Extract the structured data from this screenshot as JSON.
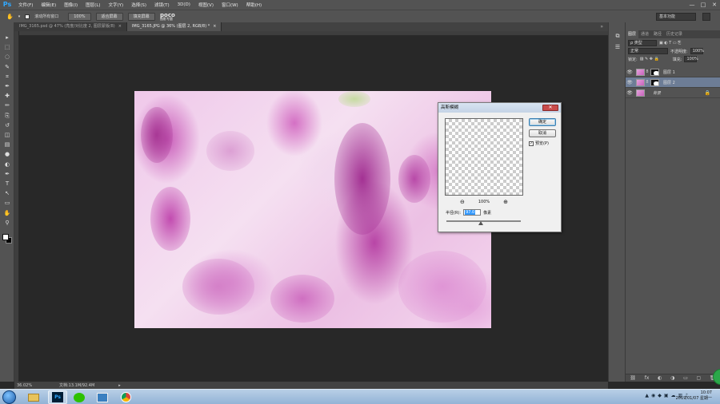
{
  "app": {
    "logo": "Ps",
    "menu": [
      "文件(F)",
      "编辑(E)",
      "图像(I)",
      "图层(L)",
      "文字(Y)",
      "选择(S)",
      "滤镜(T)",
      "3D(D)",
      "视图(V)",
      "窗口(W)",
      "帮助(H)"
    ],
    "window_controls": [
      "—",
      "□",
      "✕"
    ]
  },
  "options_bar": {
    "scroll_all_label": "滚动所有窗口",
    "zoom_100": "100%",
    "fit_screen": "适合屏幕",
    "fill_screen": "填充屏幕",
    "workspace": "基本功能",
    "poco_logo": "poco",
    "poco_sub": "图影专题"
  },
  "tabs": [
    {
      "label": "IMG_3165.psd @ 47% (亮度/对比度 2, 图层蒙版/8)",
      "close": "×"
    },
    {
      "label": "IMG_3165.JPG @ 36% (图层 2, RGB/8) *",
      "close": "×"
    }
  ],
  "tabs_more": "»",
  "toolbar": {
    "tools": [
      "move-tool",
      "marquee-tool",
      "lasso-tool",
      "quick-select-tool",
      "crop-tool",
      "eyedropper-tool",
      "healing-tool",
      "brush-tool",
      "clone-stamp-tool",
      "history-brush-tool",
      "eraser-tool",
      "gradient-tool",
      "blur-tool",
      "dodge-tool",
      "pen-tool",
      "type-tool",
      "path-select-tool",
      "shape-tool",
      "hand-tool",
      "zoom-tool"
    ],
    "glyphs": [
      "▸",
      "⬚",
      "◌",
      "✎",
      "⌗",
      "✒",
      "✚",
      "✏",
      "⎘",
      "↺",
      "◫",
      "▤",
      "●",
      "◐",
      "✒",
      "T",
      "↖",
      "▭",
      "✋",
      "⚲"
    ]
  },
  "status_bar": {
    "zoom": "36.02%",
    "doc": "文档:13.1M/92.4M",
    "arrow": "▸"
  },
  "layers_panel": {
    "tabs": [
      "图层",
      "通道",
      "路径",
      "历史记录"
    ],
    "kind_label": "ρ 类型",
    "blend_mode": "正常",
    "opacity_label": "不透明度:",
    "opacity_value": "100%",
    "lock_label": "锁定:",
    "fill_label": "填充:",
    "fill_value": "100%",
    "layers": [
      {
        "name": "图层 1",
        "active": false,
        "has_mask": true
      },
      {
        "name": "图层 2",
        "active": true,
        "has_mask": true
      },
      {
        "name": "背景",
        "active": false,
        "has_mask": false,
        "locked": true
      }
    ],
    "eye_glyph": "👁",
    "chain_glyph": "8",
    "lock_glyph": "🔒",
    "bottom_icons": [
      "⛓",
      "fx",
      "◐",
      "◑",
      "▭",
      "▢",
      "🗑"
    ]
  },
  "dialog": {
    "title": "高斯模糊",
    "close": "✕",
    "ok": "确定",
    "cancel": "取消",
    "preview_label": "预览(P)",
    "preview_checked": "✓",
    "zoom": "100%",
    "zoom_in": "⊕",
    "zoom_out": "⊖",
    "radius_label": "半径(R):",
    "radius_value": "97.0",
    "radius_unit": "像素"
  },
  "taskbar": {
    "apps": [
      "explorer",
      "photoshop",
      "wechat",
      "windows-media",
      "chrome"
    ],
    "ps_label": "Ps",
    "time": "10:07",
    "date": "2019/01/07 星期一"
  },
  "colors": {
    "ps_bg": "#535353",
    "canvas_bg": "#282828",
    "accent": "#31a8ff",
    "active_layer": "#6d7d96"
  }
}
